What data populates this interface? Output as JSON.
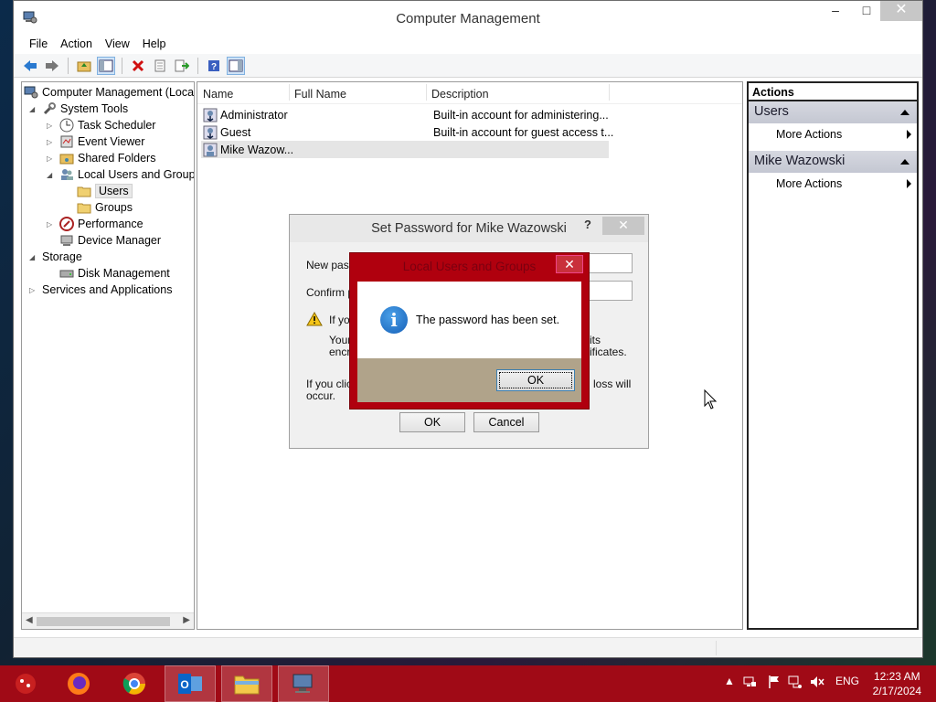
{
  "window": {
    "title": "Computer Management",
    "controls": {
      "minimize": "–",
      "maximize": "□",
      "close": "✕"
    }
  },
  "menu": [
    "File",
    "Action",
    "View",
    "Help"
  ],
  "tree": {
    "root": "Computer Management (Local",
    "items": [
      {
        "label": "System Tools"
      },
      {
        "label": "Task Scheduler"
      },
      {
        "label": "Event Viewer"
      },
      {
        "label": "Shared Folders"
      },
      {
        "label": "Local Users and Groups"
      },
      {
        "label": "Users"
      },
      {
        "label": "Groups"
      },
      {
        "label": "Performance"
      },
      {
        "label": "Device Manager"
      },
      {
        "label": "Storage"
      },
      {
        "label": "Disk Management"
      },
      {
        "label": "Services and Applications"
      }
    ]
  },
  "list": {
    "columns": [
      "Name",
      "Full Name",
      "Description"
    ],
    "rows": [
      {
        "name": "Administrator",
        "full_name": "",
        "description": "Built-in account for administering..."
      },
      {
        "name": "Guest",
        "full_name": "",
        "description": "Built-in account for guest access t..."
      },
      {
        "name": "Mike Wazow...",
        "full_name": "",
        "description": ""
      }
    ]
  },
  "actions": {
    "header": "Actions",
    "sections": [
      {
        "title": "Users",
        "item": "More Actions"
      },
      {
        "title": "Mike Wazowski",
        "item": "More Actions"
      }
    ]
  },
  "password_dialog": {
    "title": "Set Password for Mike Wazowski",
    "help": "?",
    "close": "✕",
    "new_password_label": "New pass",
    "confirm_password_label": "Confirm pa",
    "warning_line1": "If you",
    "warning_line2a": "Your",
    "warning_line2b": "encry",
    "warning_right1": "its",
    "warning_right2": "ificates.",
    "note_line1": "If you click",
    "note_line2": "occur.",
    "note_right": "loss will",
    "ok": "OK",
    "cancel": "Cancel"
  },
  "message_box": {
    "title": "Local Users and Groups",
    "close": "✕",
    "text": "The password has been set.",
    "ok": "OK"
  },
  "taskbar": {
    "tray_language": "ENG",
    "time": "12:23 AM",
    "date": "2/17/2024"
  }
}
